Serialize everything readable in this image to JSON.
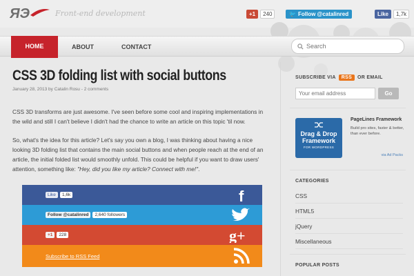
{
  "header": {
    "tagline": "Front-end development",
    "gplus": {
      "label": "+1",
      "count": "240"
    },
    "twitter": {
      "label": "Follow @catalinred"
    },
    "facebook": {
      "label": "Like",
      "count": "1,7k"
    }
  },
  "nav": {
    "items": [
      {
        "label": "HOME"
      },
      {
        "label": "ABOUT"
      },
      {
        "label": "CONTACT"
      }
    ],
    "search_placeholder": "Search"
  },
  "article": {
    "title": "CSS 3D folding list with social buttons",
    "meta": "January 28, 2013 by Catalin Rosu - 2 comments",
    "p1": "CSS 3D transforms are just awesome. I've seen before some cool and inspiring implementations in the wild and still I can't believe I didn't had the chance to write an article on this topic 'til now.",
    "p2_text": "So, what's the idea for this article? Let's say you own a blog, I was thinking about having a nice looking 3D folding list that contains the main social buttons and when people reach at the end of an article, the initial folded list would smoothly unfold. This could be helpful if you want to draw users' attention, something like: ",
    "p2_quote": "\"Hey, did you like my article? Connect with me!\"",
    "p2_end": "."
  },
  "folding_list": {
    "facebook": {
      "label": "Like",
      "count": "1,6k",
      "icon": "f"
    },
    "twitter": {
      "label": "Follow @catalinred",
      "count": "2,640 followers"
    },
    "gplus": {
      "label": "+1",
      "count": "228",
      "icon": "g+"
    },
    "rss": {
      "label": "Subscribe to RSS Feed"
    }
  },
  "sidebar": {
    "subscribe_pre": "SUBSCRIBE VIA",
    "subscribe_badge": "RSS",
    "subscribe_post": "OR EMAIL",
    "email_placeholder": "Your email address",
    "go_label": "Go",
    "ad": {
      "banner_line1": "Drag & Drop",
      "banner_line2": "Framework",
      "banner_sub": "FOR WORDPRESS",
      "title": "PageLines Framework",
      "desc": "Build pro sites, faster & better, than ever before.",
      "via": "via Ad Packs"
    },
    "categories_title": "CATEGORIES",
    "categories": [
      {
        "label": "CSS"
      },
      {
        "label": "HTML5"
      },
      {
        "label": "jQuery"
      },
      {
        "label": "Miscellaneous"
      }
    ],
    "popular_title": "POPULAR POSTS"
  },
  "colors": {
    "accent": "#c6232b",
    "facebook": "#3b5998",
    "twitter": "#2d9bd6",
    "gplus": "#d34a32",
    "rss": "#f28a1a"
  }
}
